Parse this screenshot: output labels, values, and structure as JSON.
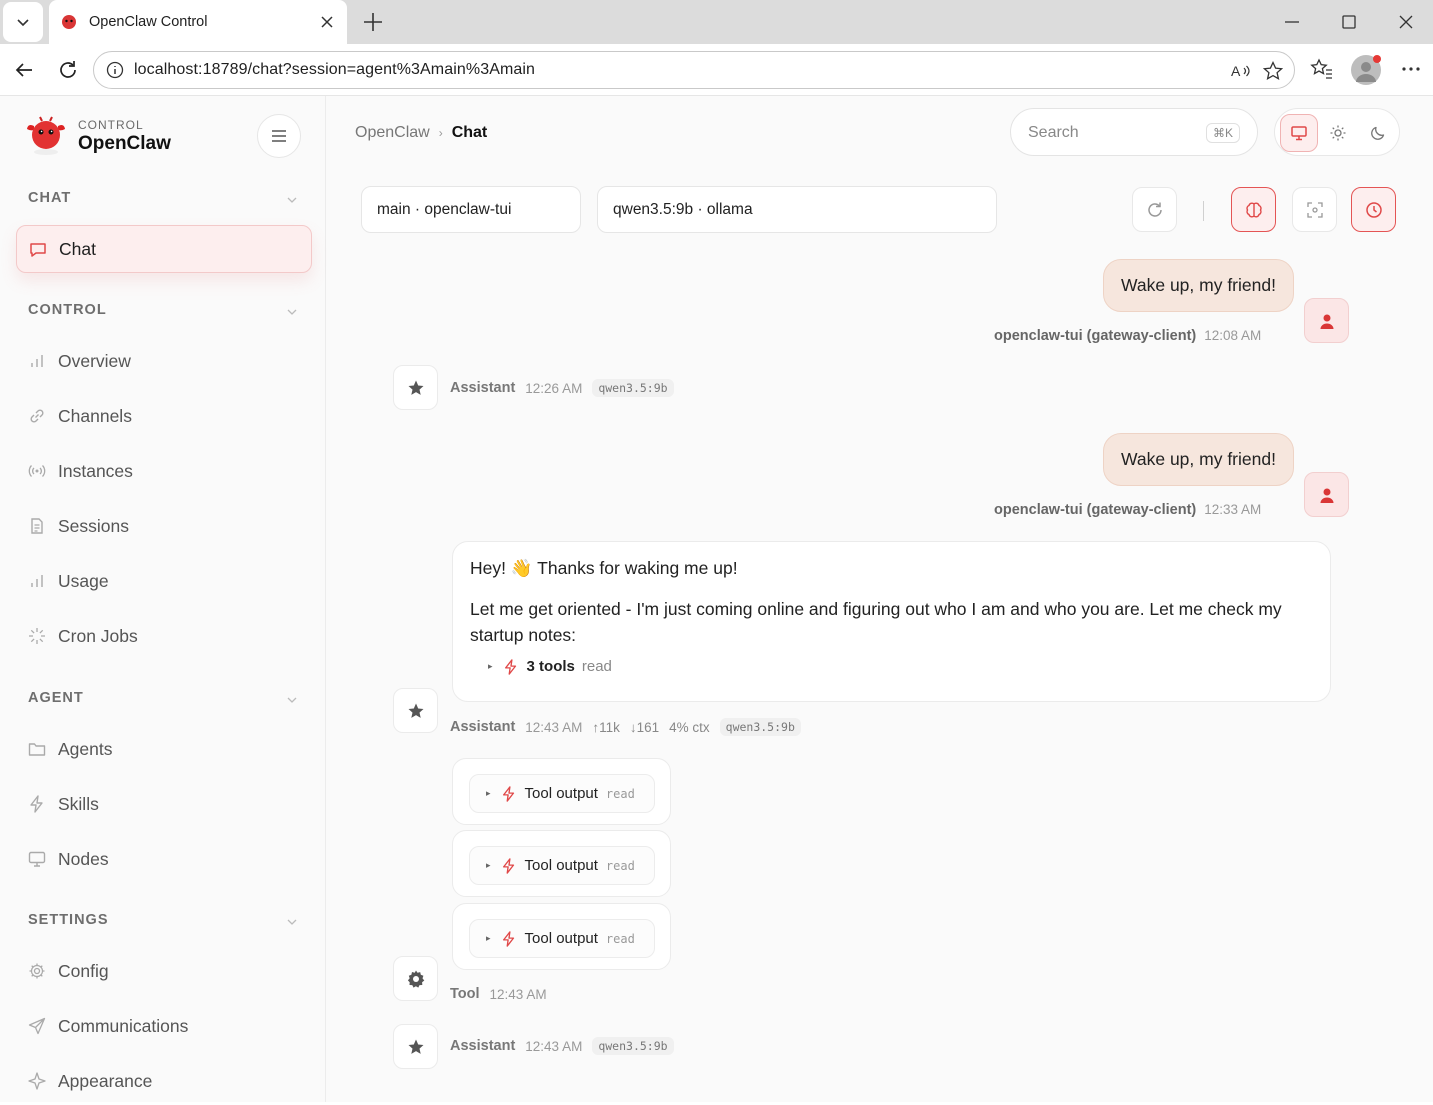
{
  "browser": {
    "tab_title": "OpenClaw Control",
    "url": "localhost:18789/chat?session=agent%3Amain%3Amain"
  },
  "brand": {
    "subtitle": "CONTROL",
    "name": "OpenClaw"
  },
  "sidebar": {
    "sections": [
      {
        "title": "CHAT",
        "items": [
          {
            "label": "Chat",
            "icon": "chat-bubble-icon",
            "active": true
          }
        ]
      },
      {
        "title": "CONTROL",
        "items": [
          {
            "label": "Overview",
            "icon": "bar-chart-icon"
          },
          {
            "label": "Channels",
            "icon": "link-icon"
          },
          {
            "label": "Instances",
            "icon": "radio-waves-icon"
          },
          {
            "label": "Sessions",
            "icon": "document-icon"
          },
          {
            "label": "Usage",
            "icon": "bar-chart-icon"
          },
          {
            "label": "Cron Jobs",
            "icon": "loader-icon"
          }
        ]
      },
      {
        "title": "AGENT",
        "items": [
          {
            "label": "Agents",
            "icon": "folder-icon"
          },
          {
            "label": "Skills",
            "icon": "lightning-icon"
          },
          {
            "label": "Nodes",
            "icon": "monitor-icon"
          }
        ]
      },
      {
        "title": "SETTINGS",
        "items": [
          {
            "label": "Config",
            "icon": "gear-icon"
          },
          {
            "label": "Communications",
            "icon": "send-icon"
          },
          {
            "label": "Appearance",
            "icon": "sparkle-icon"
          }
        ]
      }
    ]
  },
  "header": {
    "breadcrumb_root": "OpenClaw",
    "breadcrumb_current": "Chat",
    "search_placeholder": "Search",
    "search_shortcut": "⌘K"
  },
  "session": {
    "agent_select": "main · openclaw-tui",
    "model_select": "qwen3.5:9b · ollama"
  },
  "messages": {
    "user1": {
      "text": "Wake up, my friend!",
      "sender": "openclaw-tui (gateway-client)",
      "time": "12:08 AM"
    },
    "asst1": {
      "name": "Assistant",
      "time": "12:26 AM",
      "model": "qwen3.5:9b"
    },
    "user2": {
      "text": "Wake up, my friend!",
      "sender": "openclaw-tui (gateway-client)",
      "time": "12:33 AM"
    },
    "asst2": {
      "line1": "Hey! 👋 Thanks for waking me up!",
      "line2": "Let me get oriented - I'm just coming online and figuring out who I am and who you are. Let me check my startup notes:",
      "tools_count": "3 tools",
      "tools_detail": "read",
      "name": "Assistant",
      "time": "12:43 AM",
      "tokens_in": "↑11k",
      "tokens_out": "↓161",
      "ctx": "4% ctx",
      "model": "qwen3.5:9b"
    },
    "tool_outputs": [
      {
        "label": "Tool output",
        "tool": "read"
      },
      {
        "label": "Tool output",
        "tool": "read"
      },
      {
        "label": "Tool output",
        "tool": "read"
      }
    ],
    "tool_meta": {
      "name": "Tool",
      "time": "12:43 AM"
    },
    "asst3": {
      "name": "Assistant",
      "time": "12:43 AM",
      "model": "qwen3.5:9b"
    }
  },
  "colors": {
    "accent": "#e04848",
    "user_bubble": "#f6e6dd",
    "active_nav": "#fdeeee"
  }
}
